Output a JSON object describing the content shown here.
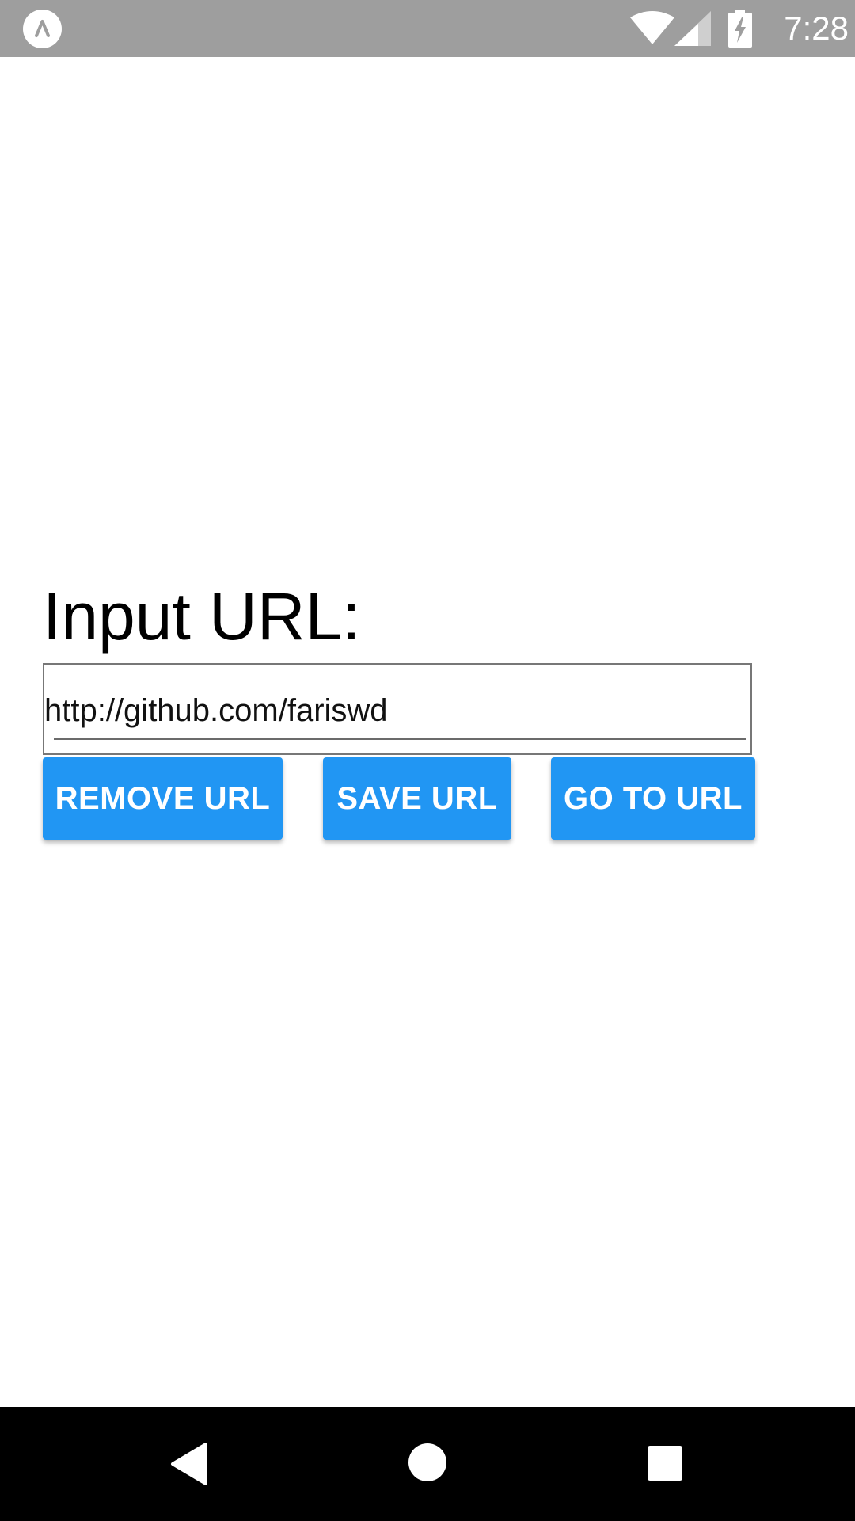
{
  "status_bar": {
    "app_icon": "app-logo-icon",
    "wifi_icon": "wifi-icon",
    "signal_icon": "cell-signal-icon",
    "battery_icon": "battery-charging-icon",
    "time": "7:28",
    "background_color": "#9e9e9e"
  },
  "main": {
    "label": "Input URL:",
    "url_input": {
      "value": "http://github.com/fariswd",
      "placeholder": ""
    },
    "buttons": {
      "remove_label": "REMOVE URL",
      "save_label": "SAVE URL",
      "go_label": "GO TO URL"
    },
    "button_color": "#2196f3"
  },
  "nav_bar": {
    "back_icon": "back-icon",
    "home_icon": "home-icon",
    "recents_icon": "recents-icon"
  }
}
